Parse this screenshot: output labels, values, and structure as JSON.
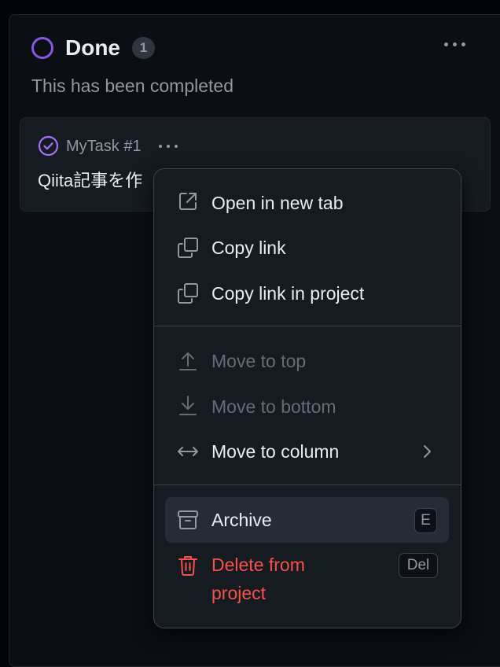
{
  "column": {
    "title": "Done",
    "count": "1",
    "description": "This has been completed",
    "status_color": "#8957e5"
  },
  "card": {
    "reference": "MyTask #1",
    "title": "Qiita記事を作",
    "icon": "check-circle-icon"
  },
  "menu": {
    "items": [
      {
        "label": "Open in new tab",
        "icon": "external-link-icon",
        "disabled": false
      },
      {
        "label": "Copy link",
        "icon": "copy-icon",
        "disabled": false
      },
      {
        "label": "Copy link in project",
        "icon": "copy-icon",
        "disabled": false
      },
      {
        "label": "Move to top",
        "icon": "arrow-up-to-line-icon",
        "disabled": true
      },
      {
        "label": "Move to bottom",
        "icon": "arrow-down-to-line-icon",
        "disabled": true
      },
      {
        "label": "Move to column",
        "icon": "arrow-both-icon",
        "disabled": false,
        "submenu": true
      },
      {
        "label": "Archive",
        "icon": "archive-icon",
        "disabled": false,
        "shortcut": "E",
        "highlighted": true
      },
      {
        "label": "Delete from project",
        "icon": "trash-icon",
        "disabled": false,
        "shortcut": "Del",
        "danger": true
      }
    ],
    "delete_line1": "Delete from",
    "delete_line2": "project"
  },
  "colors": {
    "accent_purple": "#8957e5",
    "danger": "#f85149",
    "background": "#010409"
  }
}
